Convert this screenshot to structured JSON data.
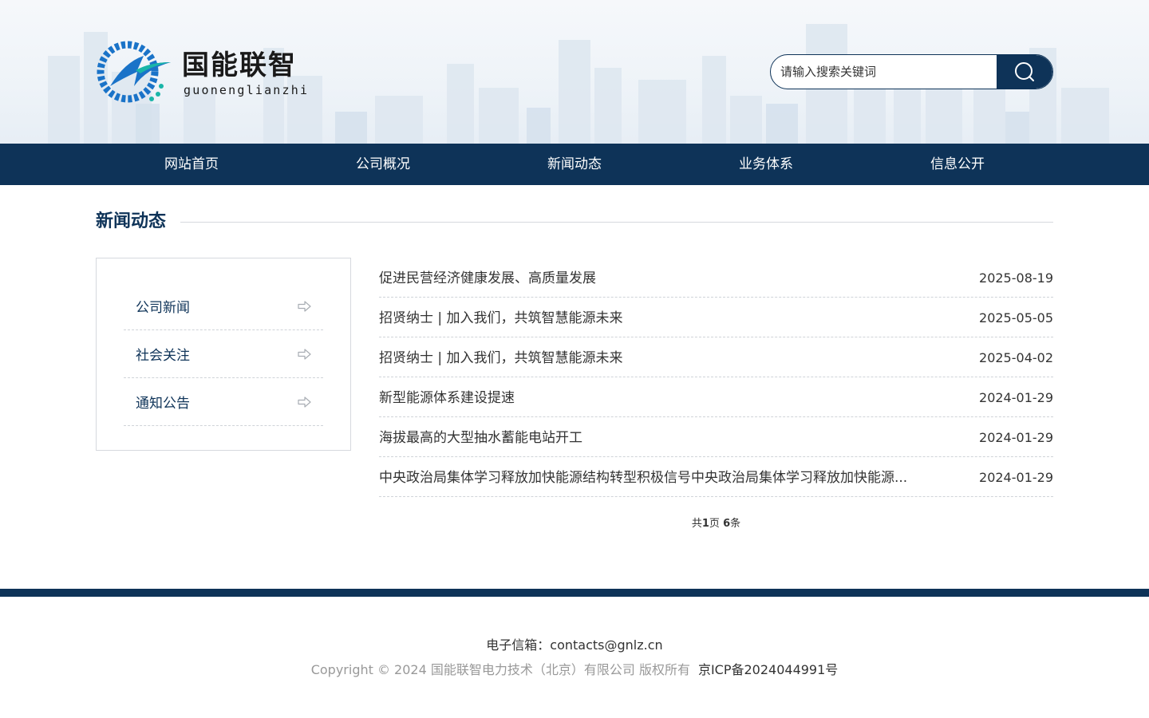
{
  "header": {
    "logo_cn": "国能联智",
    "logo_en": "guonenglianzhi"
  },
  "search": {
    "placeholder": "请输入搜索关键词",
    "icon": "search-icon"
  },
  "nav": {
    "items": [
      {
        "label": "网站首页"
      },
      {
        "label": "公司概况"
      },
      {
        "label": "新闻动态"
      },
      {
        "label": "业务体系"
      },
      {
        "label": "信息公开"
      }
    ]
  },
  "section": {
    "title": "新闻动态"
  },
  "sidebar": {
    "items": [
      {
        "label": "公司新闻"
      },
      {
        "label": "社会关注"
      },
      {
        "label": "通知公告"
      }
    ]
  },
  "news": {
    "items": [
      {
        "title": "促进民营经济健康发展、高质量发展",
        "date": "2025-08-19"
      },
      {
        "title": "招贤纳士 | 加入我们，共筑智慧能源未来",
        "date": "2025-05-05"
      },
      {
        "title": "招贤纳士 | 加入我们，共筑智慧能源未来",
        "date": "2025-04-02"
      },
      {
        "title": "新型能源体系建设提速",
        "date": "2024-01-29"
      },
      {
        "title": "海拔最高的大型抽水蓄能电站开工",
        "date": "2024-01-29"
      },
      {
        "title": "中央政治局集体学习释放加快能源结构转型积极信号中央政治局集体学习释放加快能源...",
        "date": "2024-01-29"
      }
    ]
  },
  "pager": {
    "prefix": "共",
    "pages": "1",
    "mid": "页 ",
    "count": "6",
    "suffix": "条"
  },
  "footer": {
    "email": "电子信箱：contacts@gnlz.cn",
    "copyright": "Copyright © 2024 国能联智电力技术（北京）有限公司 版权所有",
    "icp": "京ICP备2024044991号"
  },
  "colors": {
    "brand": "#0e3358",
    "logo_blue": "#1a73c8",
    "logo_teal": "#19b5a8"
  }
}
